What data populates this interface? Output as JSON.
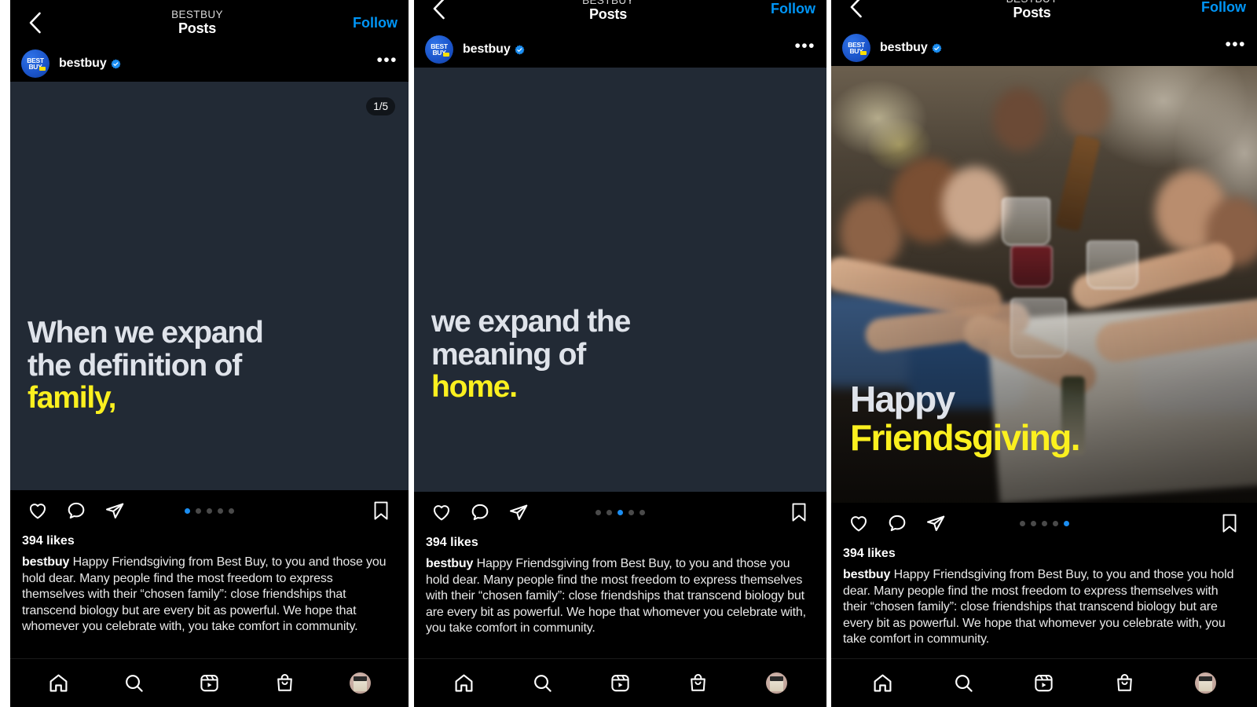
{
  "app": "Instagram",
  "colors": {
    "accent_blue": "#0095f6",
    "dot_active": "#1b8ef2",
    "highlight_yellow": "#fbf01f",
    "slide_text_white": "#dfe3ea",
    "slide_bg": "#222a35",
    "brand_blue": "#1a53c8"
  },
  "shared": {
    "header_title": "Posts",
    "header_kicker": "BESTBUY",
    "follow_label": "Follow",
    "username": "bestbuy",
    "verified_badge": "verified-badge",
    "more_menu": "•••",
    "likes": "394 likes",
    "caption_author": "bestbuy",
    "caption_text": "Happy Friendsgiving from Best Buy, to you and those you hold dear. Many people find the most freedom to express themselves with their “chosen family”: close friendships that transcend biology but are every bit as powerful. We hope that whomever you celebrate with, you take comfort in community.",
    "avatar_line1": "BEST",
    "avatar_line2": "BUY"
  },
  "bottom_nav": [
    {
      "name": "home-icon",
      "label": "Home"
    },
    {
      "name": "search-icon",
      "label": "Search"
    },
    {
      "name": "reels-icon",
      "label": "Reels"
    },
    {
      "name": "shop-icon",
      "label": "Shop"
    },
    {
      "name": "profile-avatar",
      "label": "Profile"
    }
  ],
  "action_icons": [
    {
      "name": "like-icon",
      "label": "Like"
    },
    {
      "name": "comment-icon",
      "label": "Comment"
    },
    {
      "name": "share-icon",
      "label": "Share"
    },
    {
      "name": "bookmark-icon",
      "label": "Save"
    }
  ],
  "panels": [
    {
      "id": "panel-1",
      "carousel_badge": "1/5",
      "carousel_index": 1,
      "carousel_total": 5,
      "media_type": "text-slide",
      "slide_lines": [
        {
          "text": "When we expand",
          "color": "white"
        },
        {
          "text": "the definition of",
          "color": "white"
        },
        {
          "text": "family,",
          "color": "yellow"
        }
      ],
      "show_kicker": true
    },
    {
      "id": "panel-2",
      "carousel_badge": "",
      "carousel_index": 3,
      "carousel_total": 5,
      "media_type": "text-slide",
      "slide_lines": [
        {
          "text": "we expand the",
          "color": "white"
        },
        {
          "text": "meaning of",
          "color": "white"
        },
        {
          "text": "home.",
          "color": "yellow"
        }
      ],
      "show_kicker": false
    },
    {
      "id": "panel-3",
      "carousel_badge": "",
      "carousel_index": 5,
      "carousel_total": 5,
      "media_type": "photo",
      "photo_description": "Group of friends toasting drinks around a dinner table",
      "slide_lines": [
        {
          "text": "Happy",
          "color": "white"
        },
        {
          "text": "Friendsgiving.",
          "color": "yellow"
        }
      ],
      "show_kicker": false
    }
  ]
}
